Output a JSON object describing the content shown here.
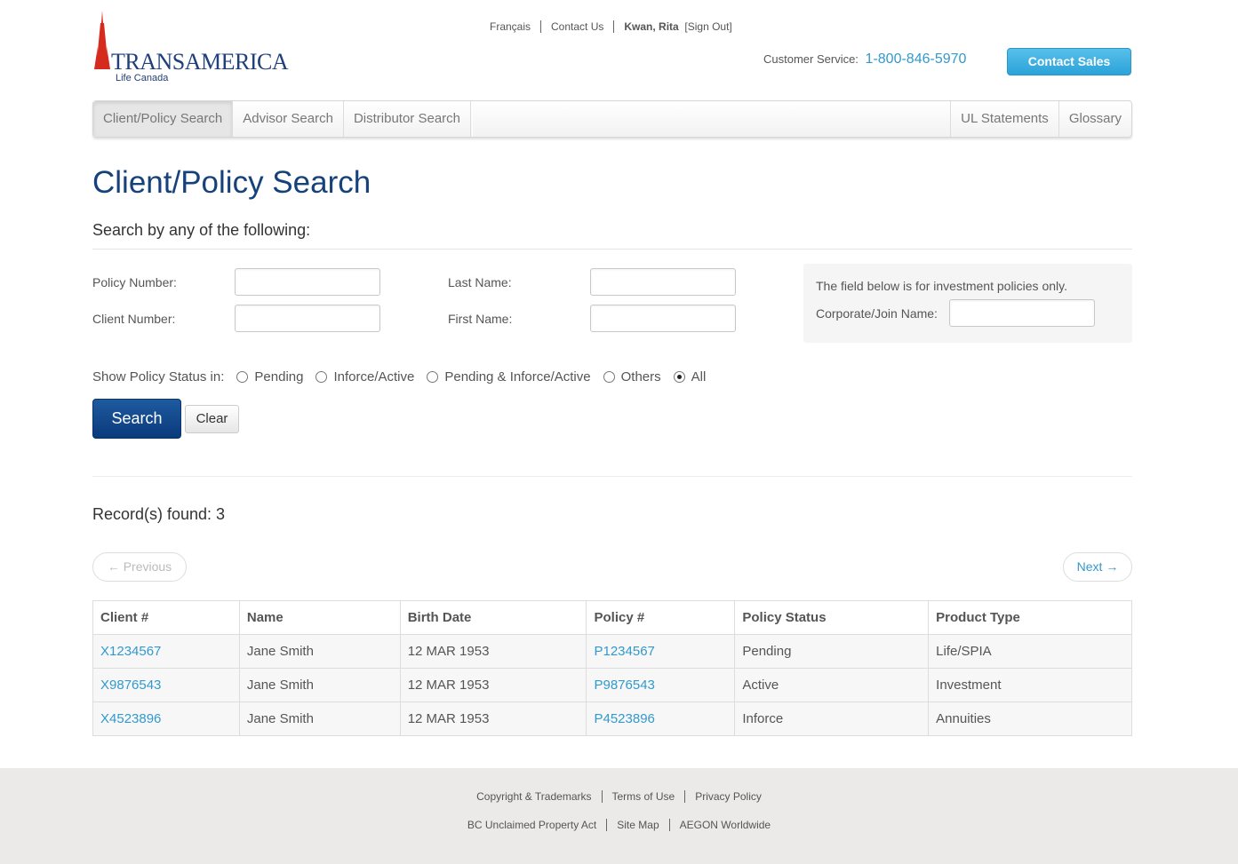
{
  "header": {
    "logo_brand": "TRANSAMERICA",
    "logo_sub": "Life Canada",
    "top_links": {
      "french": "Français",
      "contact_us": "Contact Us",
      "user": "Kwan, Rita",
      "sign_out": "[Sign Out]"
    },
    "customer_service_label": "Customer Service:",
    "customer_service_phone": "1-800-846-5970",
    "contact_sales": "Contact Sales"
  },
  "nav": {
    "left": [
      "Client/Policy Search",
      "Advisor Search",
      "Distributor Search"
    ],
    "right": [
      "UL Statements",
      "Glossary"
    ],
    "active": "Client/Policy Search"
  },
  "page": {
    "title": "Client/Policy Search",
    "subhead": "Search by any of the following:"
  },
  "form": {
    "policy_number_label": "Policy Number:",
    "client_number_label": "Client Number:",
    "last_name_label": "Last Name:",
    "first_name_label": "First Name:",
    "policy_number_value": "",
    "client_number_value": "",
    "last_name_value": "",
    "first_name_value": "",
    "investment_note": "The field below is for investment policies only.",
    "corporate_label": "Corporate/Join Name:",
    "corporate_value": "",
    "status_label": "Show Policy Status in:",
    "status_options": [
      "Pending",
      "Inforce/Active",
      "Pending & Inforce/Active",
      "Others",
      "All"
    ],
    "status_selected": "All",
    "search_button": "Search",
    "clear_button": "Clear"
  },
  "results": {
    "records_found": "Record(s) found: 3",
    "previous": "← Previous",
    "next": "Next →",
    "columns": [
      "Client #",
      "Name",
      "Birth Date",
      "Policy #",
      "Policy Status",
      "Product Type"
    ],
    "rows": [
      {
        "client": "X1234567",
        "name": "Jane Smith",
        "birth": "12 MAR 1953",
        "policy": "P1234567",
        "status": "Pending",
        "product": "Life/SPIA"
      },
      {
        "client": "X9876543",
        "name": "Jane Smith",
        "birth": "12 MAR 1953",
        "policy": "P9876543",
        "status": "Active",
        "product": "Investment"
      },
      {
        "client": "X4523896",
        "name": "Jane Smith",
        "birth": "12 MAR 1953",
        "policy": "P4523896",
        "status": "Inforce",
        "product": "Annuities"
      }
    ]
  },
  "footer": {
    "row1": [
      "Copyright & Trademarks",
      "Terms of Use",
      "Privacy Policy"
    ],
    "row2": [
      "BC Unclaimed Property Act",
      "Site Map",
      "AEGON Worldwide"
    ]
  },
  "colors": {
    "brand_blue": "#15427a",
    "link_blue": "#3399cc",
    "logo_red": "#d52b1e",
    "contact_sales_bg": "#2ba3d9"
  }
}
